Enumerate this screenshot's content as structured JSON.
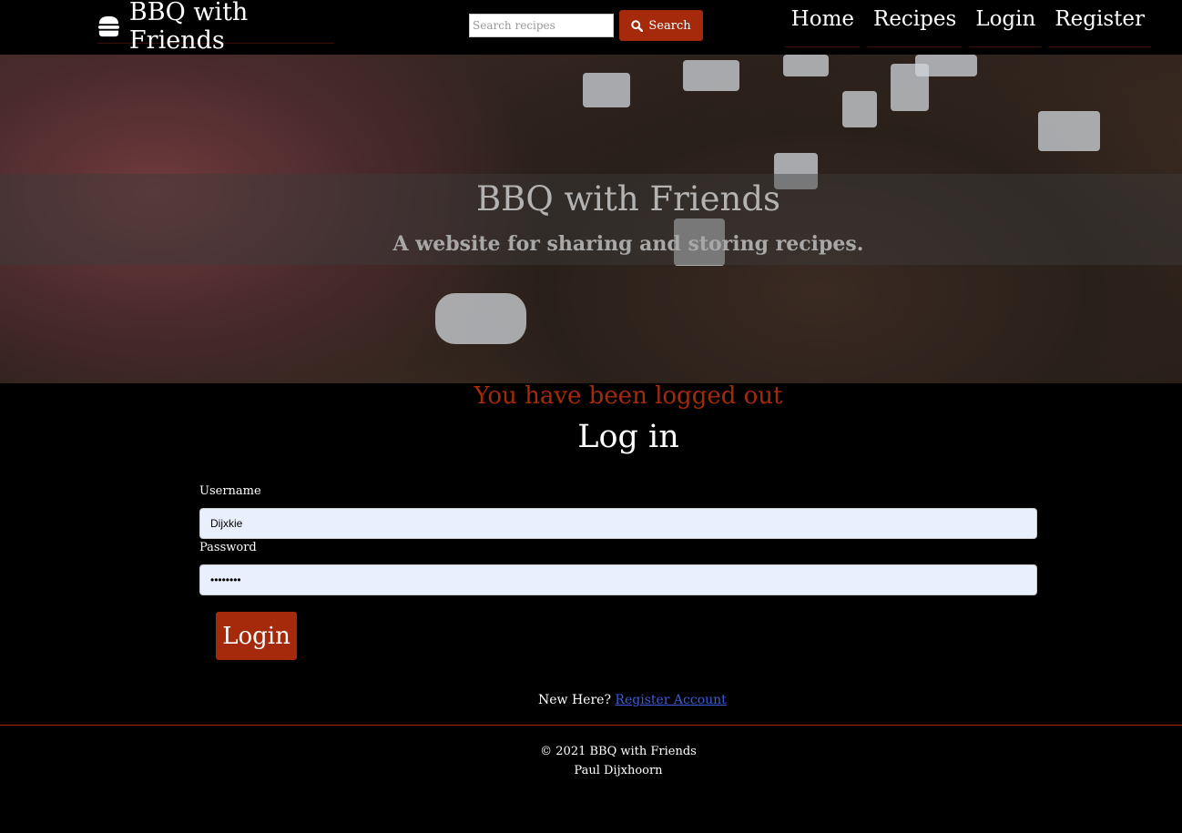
{
  "navbar": {
    "brand": "BBQ with Friends",
    "brand_icon": "hamburger-icon",
    "search_placeholder": "Search recipes",
    "search_label": "Search",
    "search_icon": "search-icon",
    "links": [
      "Home",
      "Recipes",
      "Login",
      "Register"
    ]
  },
  "hero": {
    "title": "BBQ with Friends",
    "subtitle": "A website for sharing and storing recipes."
  },
  "main": {
    "flash_message": "You have been logged out",
    "heading": "Log in",
    "username_label": "Username",
    "username_value": "Dijxkie",
    "password_label": "Password",
    "password_value": "••••••••",
    "login_label": "Login",
    "new_here": "New Here?",
    "register_link": "Register Account"
  },
  "footer": {
    "copyright": "© 2021 BBQ with Friends",
    "author": "Paul Dijxhoorn"
  },
  "colors": {
    "accent": "#a52a0c",
    "background": "#000000",
    "input_bg": "#e8f0fe",
    "link": "#3b5bdb"
  }
}
